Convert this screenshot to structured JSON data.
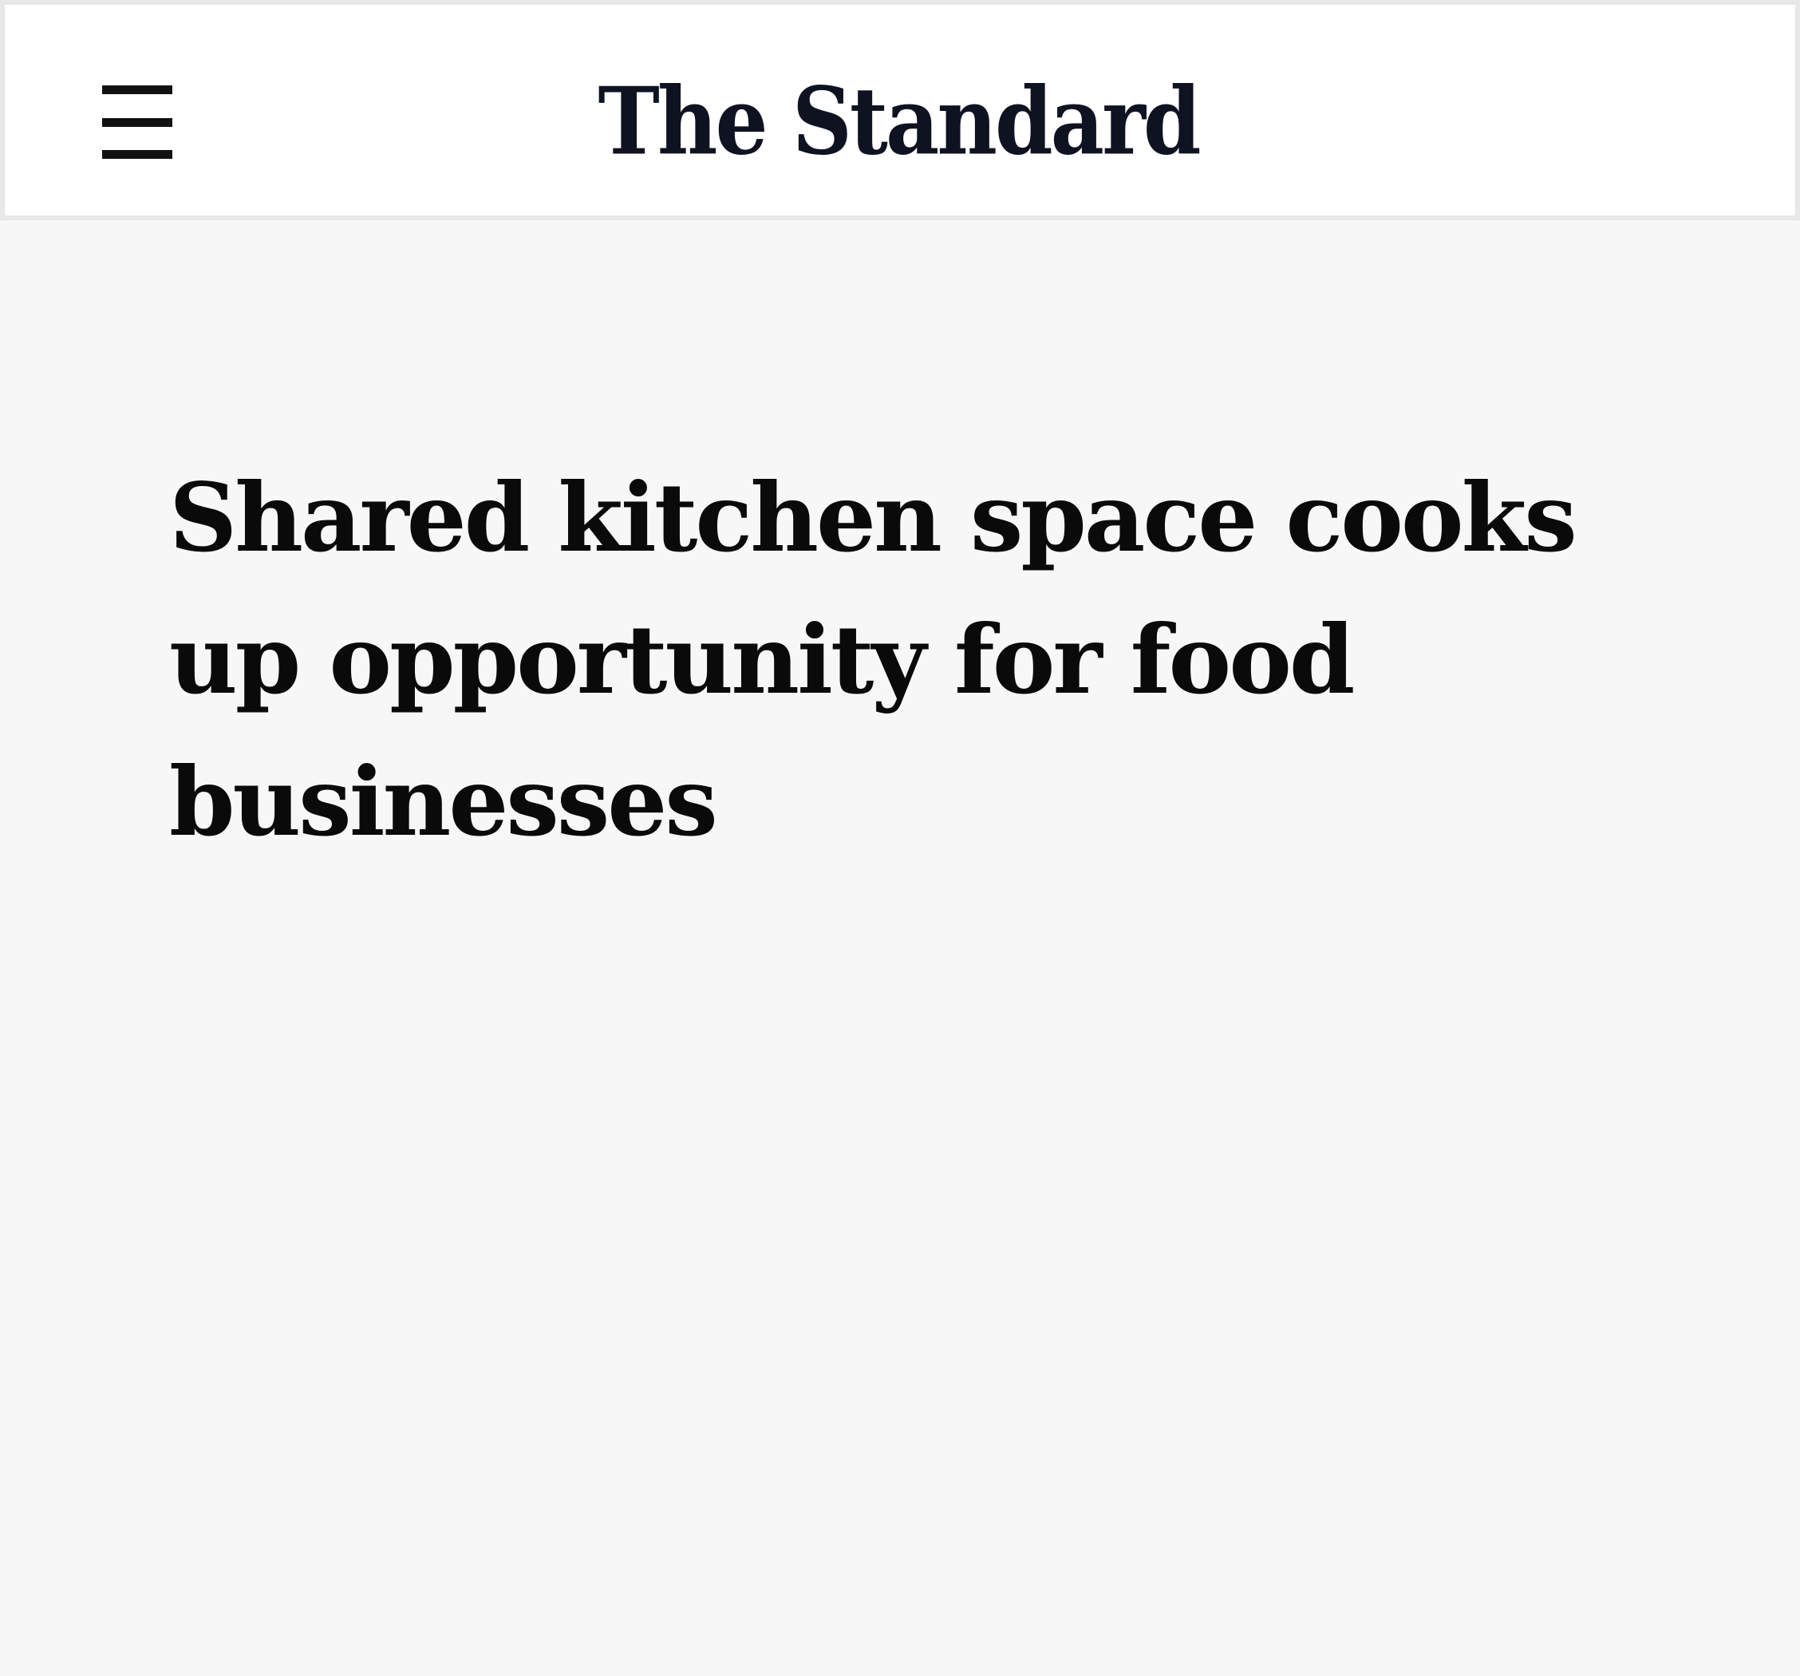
{
  "header": {
    "menu_icon": "hamburger-menu-icon",
    "logo_text": "The Standard"
  },
  "article": {
    "headline": "Shared kitchen space cooks up opportunity for food businesses"
  },
  "colors": {
    "background": "#f7f7f7",
    "header_background": "#ffffff",
    "header_border": "#e8e8e8",
    "text": "#0a0a0a",
    "logo": "#0f1220"
  }
}
